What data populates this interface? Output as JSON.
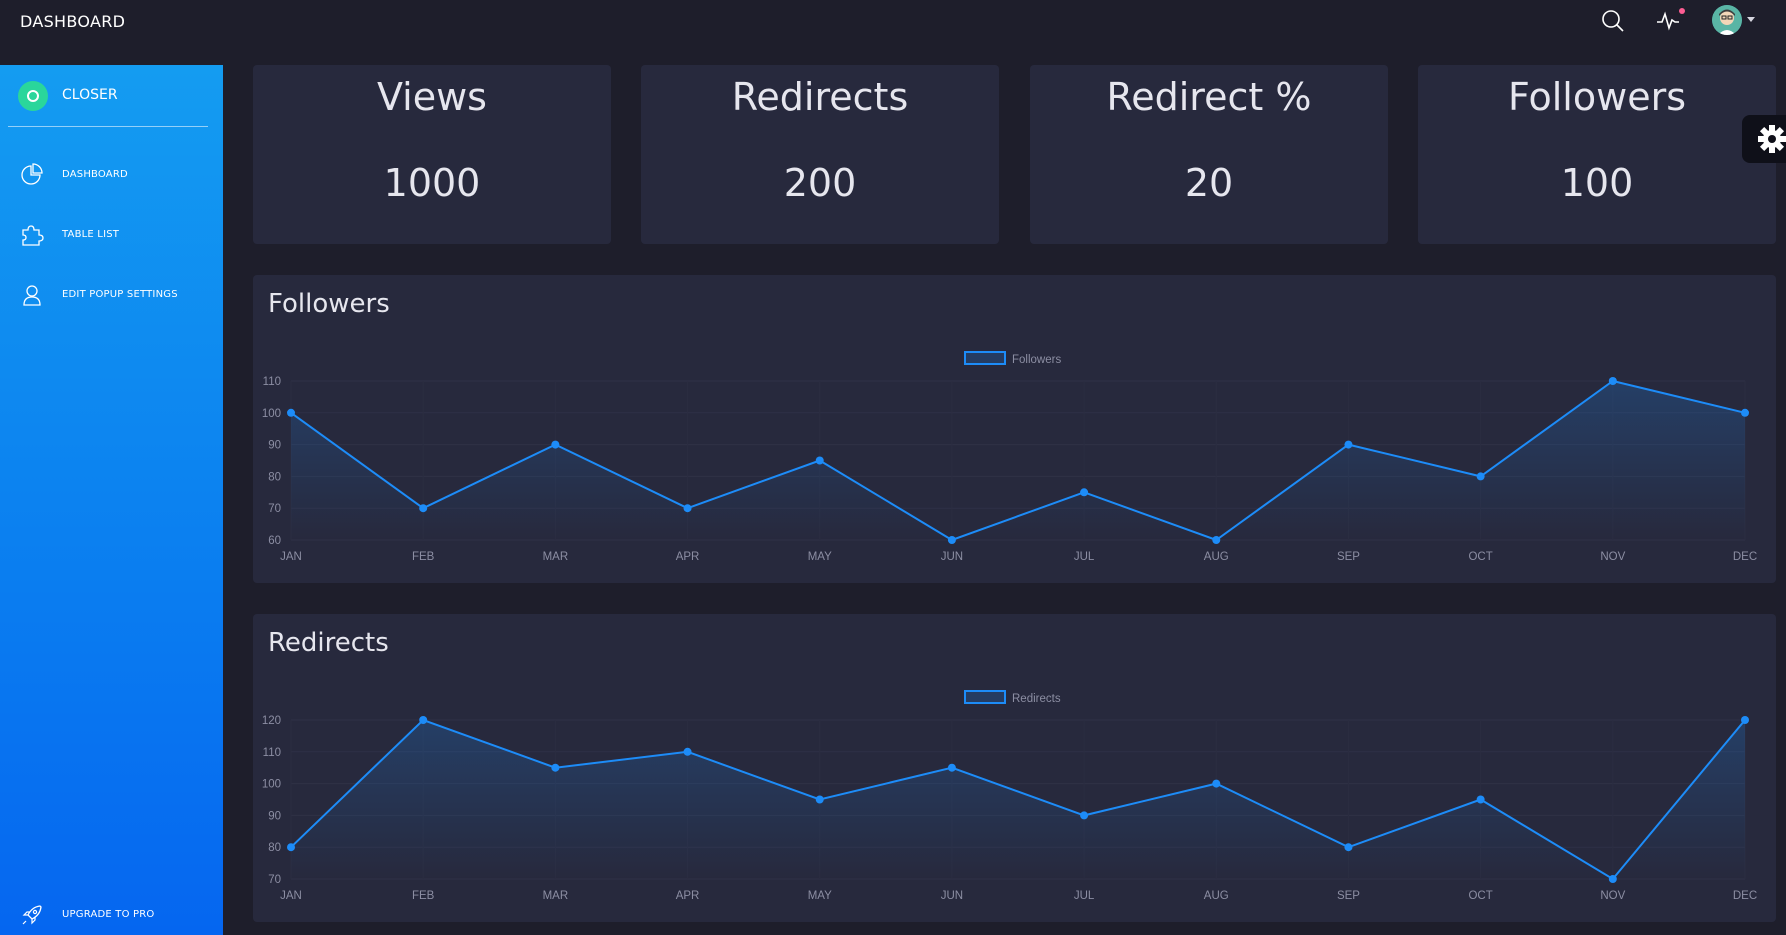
{
  "topbar": {
    "title": "DASHBOARD",
    "search_icon": "search-icon",
    "activity_icon": "activity-pulse-icon",
    "avatar": "user-avatar"
  },
  "sidebar": {
    "logo_text": "CLOSER",
    "items": [
      {
        "label": "DASHBOARD",
        "icon": "pie-chart-icon"
      },
      {
        "label": "TABLE LIST",
        "icon": "puzzle-icon"
      },
      {
        "label": "EDIT POPUP SETTINGS",
        "icon": "user-icon"
      },
      {
        "label": "UPGRADE TO PRO",
        "icon": "rocket-icon"
      }
    ]
  },
  "stats": [
    {
      "label": "Views",
      "value": "1000"
    },
    {
      "label": "Redirects",
      "value": "200"
    },
    {
      "label": "Redirect %",
      "value": "20"
    },
    {
      "label": "Followers",
      "value": "100"
    }
  ],
  "colors": {
    "accent": "#1d8cf8",
    "card": "#27293d",
    "background": "#1e1e2b",
    "sidebar_top": "#149cf1",
    "sidebar_bottom": "#0566f0"
  },
  "chart_data": [
    {
      "type": "line",
      "title": "Followers",
      "categories": [
        "JAN",
        "FEB",
        "MAR",
        "APR",
        "MAY",
        "JUN",
        "JUL",
        "AUG",
        "SEP",
        "OCT",
        "NOV",
        "DEC"
      ],
      "series": [
        {
          "name": "Followers",
          "values": [
            100,
            70,
            90,
            70,
            85,
            60,
            75,
            60,
            90,
            80,
            110,
            100
          ]
        }
      ],
      "ylim": [
        60,
        110
      ],
      "yticks": [
        60,
        70,
        80,
        90,
        100,
        110
      ],
      "legend": "top-center",
      "grid": true,
      "fill": true
    },
    {
      "type": "line",
      "title": "Redirects",
      "categories": [
        "JAN",
        "FEB",
        "MAR",
        "APR",
        "MAY",
        "JUN",
        "JUL",
        "AUG",
        "SEP",
        "OCT",
        "NOV",
        "DEC"
      ],
      "series": [
        {
          "name": "Redirects",
          "values": [
            80,
            120,
            105,
            110,
            95,
            105,
            90,
            100,
            80,
            95,
            70,
            120
          ]
        }
      ],
      "ylim": [
        70,
        120
      ],
      "yticks": [
        70,
        80,
        90,
        100,
        110,
        120
      ],
      "legend": "top-center",
      "grid": true,
      "fill": true
    }
  ]
}
